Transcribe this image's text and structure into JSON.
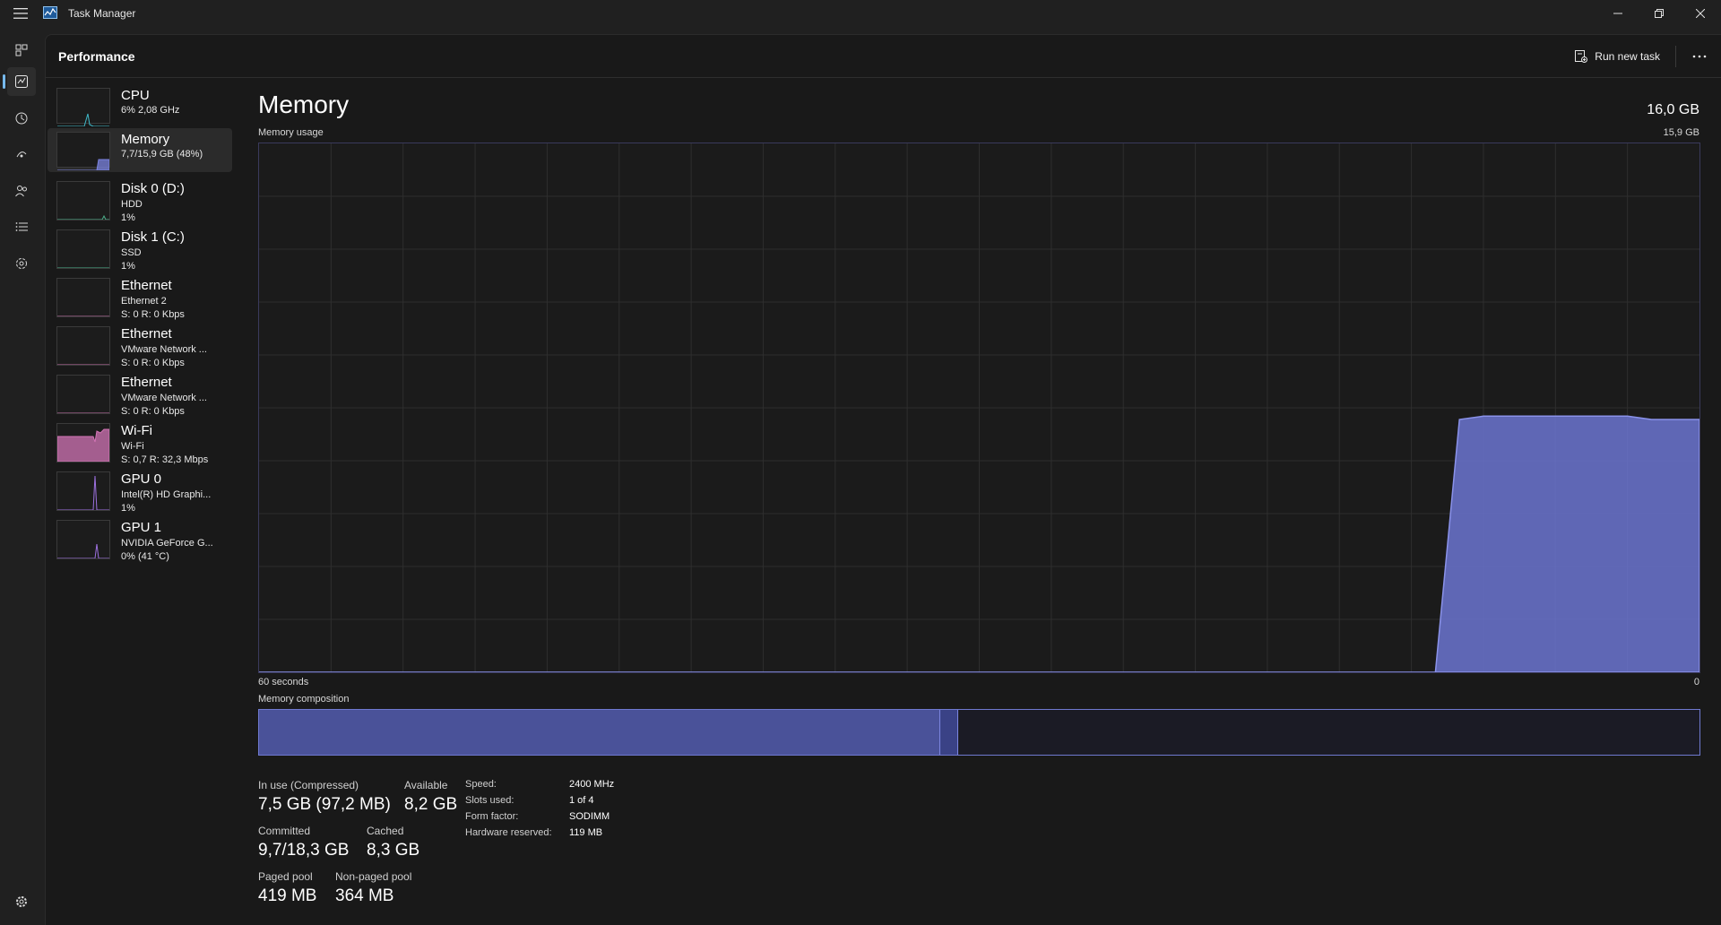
{
  "window": {
    "title": "Task Manager"
  },
  "header": {
    "title": "Performance",
    "run_new_task": "Run new task"
  },
  "devices": [
    {
      "name": "CPU",
      "line1": "6%  2,08 GHz",
      "line2": "",
      "color": "#3fb9c9"
    },
    {
      "name": "Memory",
      "line1": "7,7/15,9 GB (48%)",
      "line2": "",
      "color": "#7b83e0"
    },
    {
      "name": "Disk 0 (D:)",
      "line1": "HDD",
      "line2": "1%",
      "color": "#4caf8a"
    },
    {
      "name": "Disk 1 (C:)",
      "line1": "SSD",
      "line2": "1%",
      "color": "#4caf8a"
    },
    {
      "name": "Ethernet",
      "line1": "Ethernet 2",
      "line2": "S: 0  R: 0 Kbps",
      "color": "#c46fa8"
    },
    {
      "name": "Ethernet",
      "line1": "VMware Network ...",
      "line2": "S: 0  R: 0 Kbps",
      "color": "#c46fa8"
    },
    {
      "name": "Ethernet",
      "line1": "VMware Network ...",
      "line2": "S: 0  R: 0 Kbps",
      "color": "#c46fa8"
    },
    {
      "name": "Wi-Fi",
      "line1": "Wi-Fi",
      "line2": "S: 0,7  R: 32,3 Mbps",
      "color": "#d274b5"
    },
    {
      "name": "GPU 0",
      "line1": "Intel(R) HD Graphi...",
      "line2": "1%",
      "color": "#9d71e0"
    },
    {
      "name": "GPU 1",
      "line1": "NVIDIA GeForce G...",
      "line2": "0%  (41 °C)",
      "color": "#9d71e0"
    }
  ],
  "memory": {
    "title": "Memory",
    "total": "16,0 GB",
    "usage_label": "Memory usage",
    "usage_max": "15,9 GB",
    "time_left": "60 seconds",
    "time_right": "0",
    "composition_label": "Memory composition",
    "in_use_fraction": 0.472,
    "modified_fraction": 0.013,
    "stats": {
      "in_use_label": "In use (Compressed)",
      "in_use_value": "7,5 GB (97,2 MB)",
      "available_label": "Available",
      "available_value": "8,2 GB",
      "committed_label": "Committed",
      "committed_value": "9,7/18,3 GB",
      "cached_label": "Cached",
      "cached_value": "8,3 GB",
      "paged_label": "Paged pool",
      "paged_value": "419 MB",
      "nonpaged_label": "Non-paged pool",
      "nonpaged_value": "364 MB"
    },
    "props": [
      {
        "key": "Speed:",
        "value": "2400 MHz"
      },
      {
        "key": "Slots used:",
        "value": "1 of 4"
      },
      {
        "key": "Form factor:",
        "value": "SODIMM"
      },
      {
        "key": "Hardware reserved:",
        "value": "119 MB"
      }
    ]
  },
  "chart_data": {
    "type": "area",
    "x": [
      60,
      59,
      58,
      57,
      56,
      55,
      54,
      53,
      52,
      51,
      50,
      49,
      48,
      47,
      46,
      45,
      44,
      43,
      42,
      41,
      40,
      39,
      38,
      37,
      36,
      35,
      34,
      33,
      32,
      31,
      30,
      29,
      28,
      27,
      26,
      25,
      24,
      23,
      22,
      21,
      20,
      19,
      18,
      17,
      16,
      15,
      14,
      13,
      12,
      11,
      10,
      9,
      8,
      7,
      6,
      5,
      4,
      3,
      2,
      1,
      0
    ],
    "series": [
      {
        "values": [
          0,
          0,
          0,
          0,
          0,
          0,
          0,
          0,
          0,
          0,
          0,
          0,
          0,
          0,
          0,
          0,
          0,
          0,
          0,
          0,
          0,
          0,
          0,
          0,
          0,
          0,
          0,
          0,
          0,
          0,
          0,
          0,
          0,
          0,
          0,
          0,
          0,
          0,
          0,
          0,
          0,
          0,
          0,
          0,
          0,
          0,
          0,
          0,
          0,
          0,
          7.6,
          7.7,
          7.7,
          7.7,
          7.7,
          7.7,
          7.7,
          7.7,
          7.6,
          7.6,
          7.6
        ]
      }
    ],
    "xlabel": "60 seconds",
    "ylim": [
      0,
      15.9
    ],
    "grid": true,
    "color": "#6b74d0"
  }
}
